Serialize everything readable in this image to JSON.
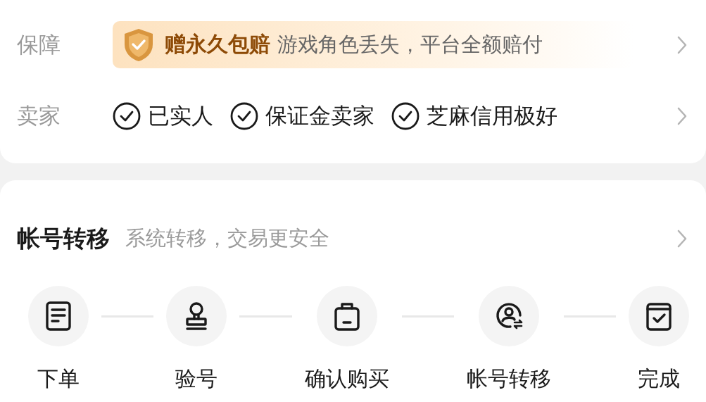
{
  "guarantee": {
    "label": "保障",
    "highlight": "赠永久包赔",
    "text": "游戏角色丢失，平台全额赔付"
  },
  "seller": {
    "label": "卖家",
    "badges": [
      "已实人",
      "保证金卖家",
      "芝麻信用极好"
    ]
  },
  "transfer": {
    "title": "帐号转移",
    "subtitle": "系统转移，交易更安全",
    "steps": [
      {
        "kind": "order",
        "label": "下单"
      },
      {
        "kind": "verify",
        "label": "验号"
      },
      {
        "kind": "confirm",
        "label": "确认购买"
      },
      {
        "kind": "transfer",
        "label": "帐号转移"
      },
      {
        "kind": "done",
        "label": "完成"
      }
    ]
  }
}
